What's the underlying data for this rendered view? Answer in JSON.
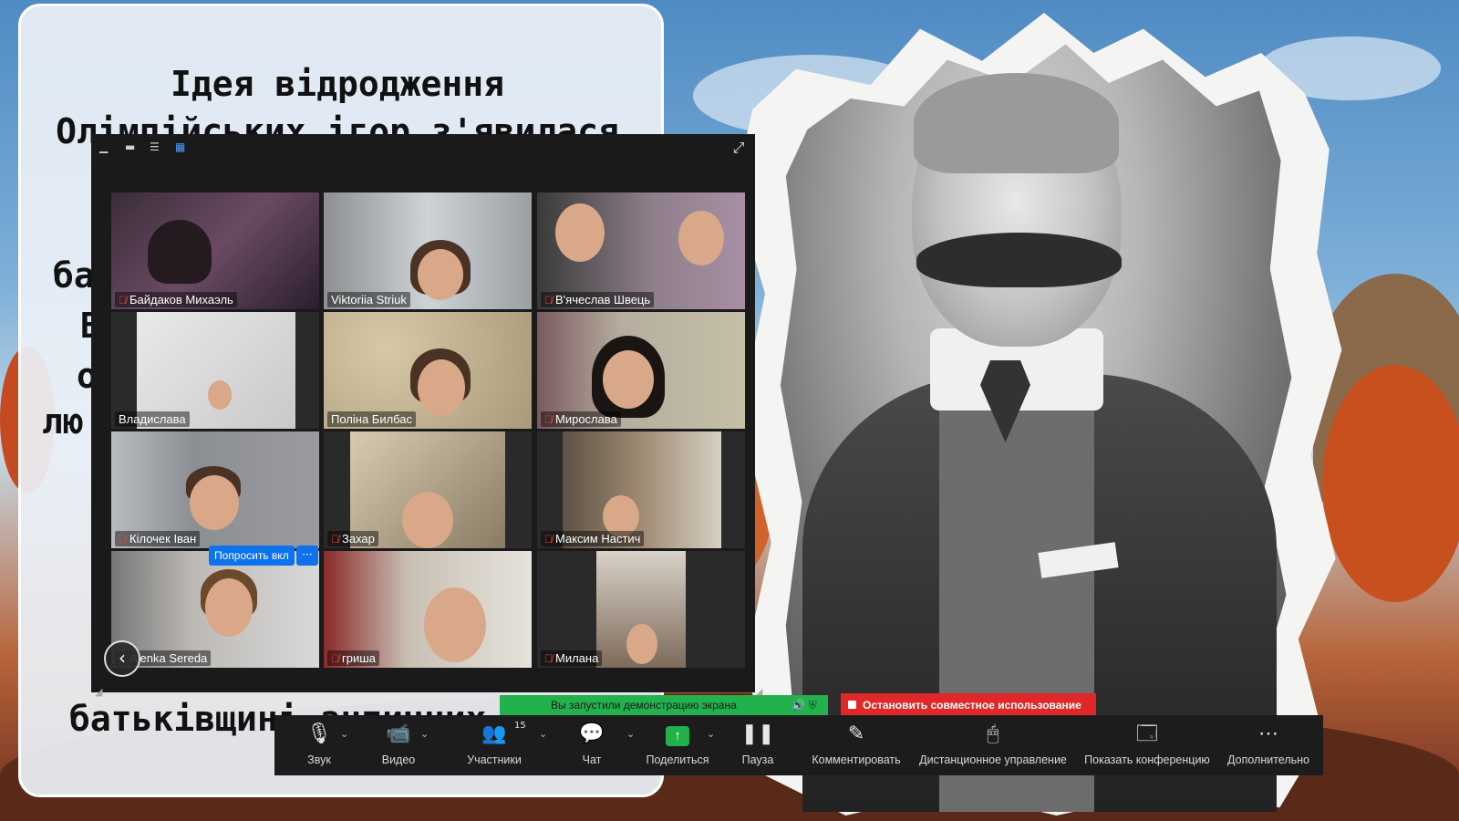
{
  "slide": {
    "title_line1": "Ідея відродження",
    "title_line2": "Олімпійських ігор з'явилася",
    "frag_1": "ба",
    "frag_2": "В",
    "frag_3": "о",
    "frag_4": "лю",
    "bottom_line": "батьківщині античних"
  },
  "gallery": {
    "participants": [
      {
        "name": "Байдаков Михаэль",
        "muted": true
      },
      {
        "name": "Viktoriia Striuk",
        "muted": false
      },
      {
        "name": "В'ячеслав Швець",
        "muted": true
      },
      {
        "name": "Владислава",
        "muted": false
      },
      {
        "name": "Поліна Билбас",
        "muted": false
      },
      {
        "name": "Мирослава",
        "muted": true
      },
      {
        "name": "Кілочек Іван",
        "muted": true
      },
      {
        "name": "Захар",
        "muted": true
      },
      {
        "name": "Максим  Настич",
        "muted": true
      },
      {
        "name": "Alenka Sereda",
        "muted": true
      },
      {
        "name": "гриша",
        "muted": true
      },
      {
        "name": "Милана",
        "muted": true
      }
    ],
    "ask_unmute_label": "Попросить вкл",
    "more_label": "···"
  },
  "share_banner": {
    "text": "Вы запустили демонстрацию экрана",
    "stop_label": "Остановить совместное использование"
  },
  "toolbar": {
    "audio_label": "Звук",
    "video_label": "Видео",
    "participants_label": "Участники",
    "participants_count": "15",
    "chat_label": "Чат",
    "share_label": "Поделиться",
    "pause_label": "Пауза",
    "annotate_label": "Комментировать",
    "remote_label": "Дистанционное управление",
    "show_meeting_label": "Показать конференцию",
    "more_label": "Дополнительно"
  },
  "colors": {
    "share_green": "#23b14d",
    "stop_red": "#e02828",
    "zoom_blue": "#0e72ed",
    "muted_red": "#ff3b30"
  }
}
